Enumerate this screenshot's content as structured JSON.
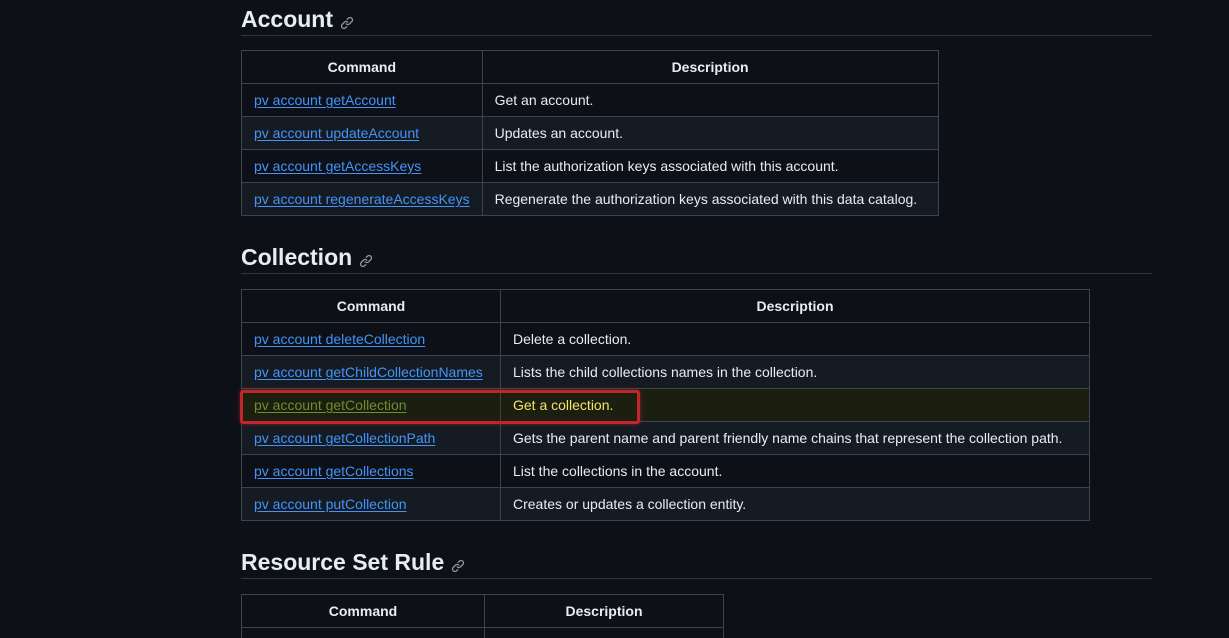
{
  "sections": [
    {
      "title": "Account",
      "headers": [
        "Command",
        "Description"
      ],
      "rows": [
        {
          "command": "pv account getAccount",
          "description": "Get an account."
        },
        {
          "command": "pv account updateAccount",
          "description": "Updates an account."
        },
        {
          "command": "pv account getAccessKeys",
          "description": "List the authorization keys associated with this account."
        },
        {
          "command": "pv account regenerateAccessKeys",
          "description": "Regenerate the authorization keys associated with this data catalog."
        }
      ]
    },
    {
      "title": "Collection",
      "headers": [
        "Command",
        "Description"
      ],
      "rows": [
        {
          "command": "pv account deleteCollection",
          "description": "Delete a collection."
        },
        {
          "command": "pv account getChildCollectionNames",
          "description": "Lists the child collections names in the collection."
        },
        {
          "command": "pv account getCollection",
          "description": "Get a collection."
        },
        {
          "command": "pv account getCollectionPath",
          "description": "Gets the parent name and parent friendly name chains that represent the collection path."
        },
        {
          "command": "pv account getCollections",
          "description": "List the collections in the account."
        },
        {
          "command": "pv account putCollection",
          "description": "Creates or updates a collection entity."
        }
      ]
    },
    {
      "title": "Resource Set Rule",
      "headers": [
        "Command",
        "Description"
      ],
      "rows": []
    }
  ],
  "highlight": {
    "section": "Collection",
    "row_command": "pv account getCollection"
  },
  "colors": {
    "background": "#0d1117",
    "link": "#4493f8",
    "highlight_border": "#c0262a",
    "highlight_text": "#f2e36b"
  }
}
